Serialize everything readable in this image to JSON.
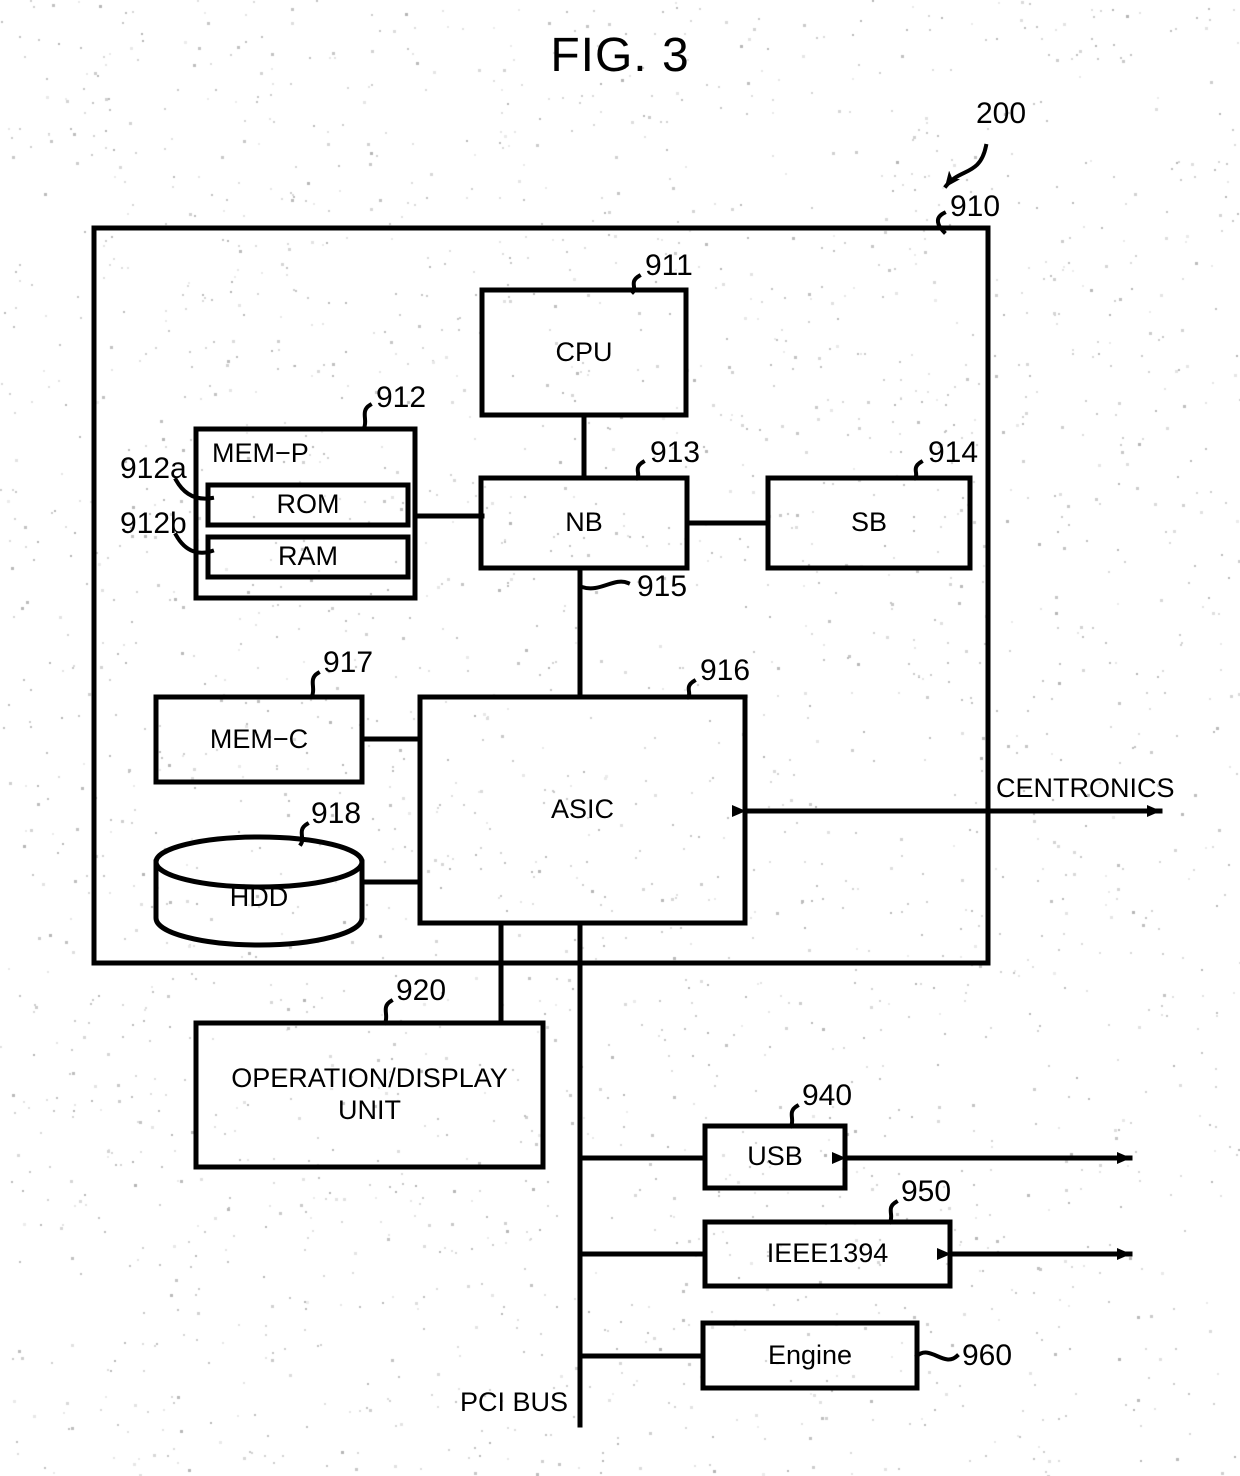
{
  "figure": {
    "title": "FIG. 3",
    "type": "patent-block-diagram"
  },
  "reference_numerals": {
    "system": "200",
    "controller": "910",
    "cpu": "911",
    "mem_p": "912",
    "rom": "912a",
    "ram": "912b",
    "nb": "913",
    "sb": "914",
    "nb_asic_link": "915",
    "asic": "916",
    "mem_c": "917",
    "hdd": "918",
    "operation_display_unit": "920",
    "usb": "940",
    "ieee1394": "950",
    "engine": "960"
  },
  "blocks": {
    "cpu": "CPU",
    "mem_p": "MEM−P",
    "rom": "ROM",
    "ram": "RAM",
    "nb": "NB",
    "sb": "SB",
    "asic": "ASIC",
    "mem_c": "MEM−C",
    "hdd": "HDD",
    "operation_display_unit": "OPERATION/DISPLAY UNIT",
    "usb": "USB",
    "ieee1394": "IEEE1394",
    "engine": "Engine"
  },
  "bus_labels": {
    "pci_bus": "PCI BUS",
    "centronics": "CENTRONICS"
  },
  "colors": {
    "line": "#000000",
    "background": "#ffffff",
    "text": "#000000"
  }
}
